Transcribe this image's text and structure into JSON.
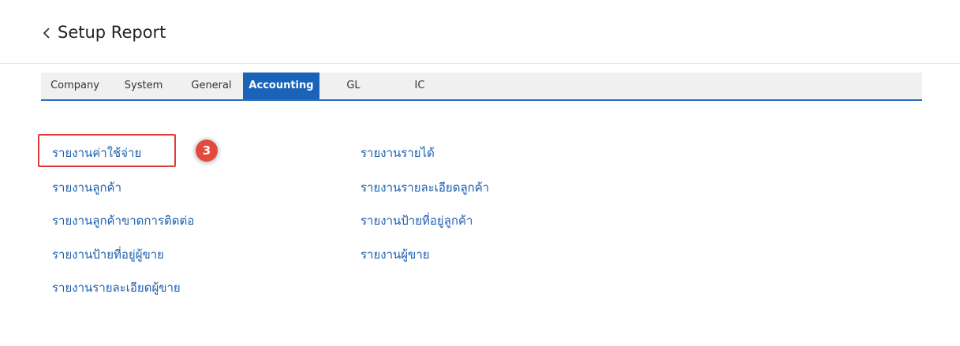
{
  "header": {
    "back_icon": "chevron-left-icon",
    "title": "Setup Report"
  },
  "tabs": [
    {
      "label": "Company",
      "active": false
    },
    {
      "label": "System",
      "active": false
    },
    {
      "label": "General",
      "active": false
    },
    {
      "label": "Accounting",
      "active": true
    },
    {
      "label": "GL",
      "active": false
    },
    {
      "label": "IC",
      "active": false
    }
  ],
  "report_links": {
    "left": [
      "รายงานค่าใช้จ่าย",
      "รายงานลูกค้า",
      "รายงานลูกค้าขาดการติดต่อ",
      "รายงานป้ายที่อยู่ผู้ขาย",
      "รายงานรายละเอียดผู้ขาย"
    ],
    "right": [
      "รายงานรายได้",
      "รายงานรายละเอียดลูกค้า",
      "รายงานป้ายที่อยู่ลูกค้า",
      "รายงานผู้ขาย"
    ]
  },
  "annotation": {
    "step_number": "3",
    "highlight_color": "#e03a3a",
    "badge_color": "#e24b3c"
  },
  "colors": {
    "accent": "#1a63b8",
    "link": "#1c5fb0"
  }
}
